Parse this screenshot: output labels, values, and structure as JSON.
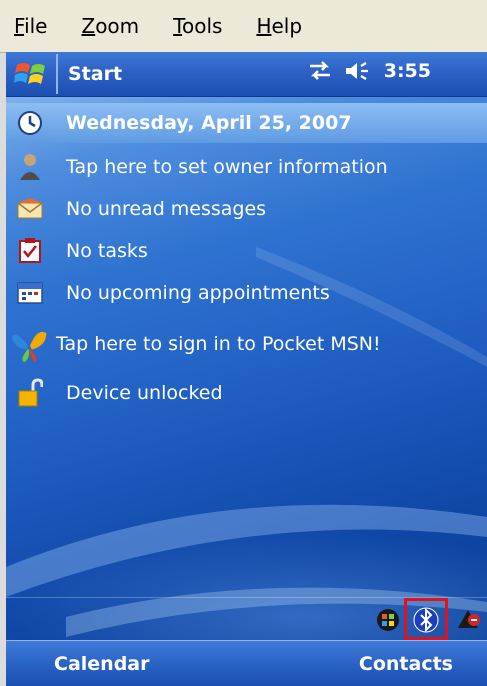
{
  "menubar": {
    "items": [
      {
        "label_ul": "F",
        "label_rest": "ile"
      },
      {
        "label_ul": "Z",
        "label_rest": "oom"
      },
      {
        "label_ul": "T",
        "label_rest": "ools"
      },
      {
        "label_ul": "H",
        "label_rest": "elp"
      }
    ]
  },
  "titlebar": {
    "start_label": "Start",
    "clock": "3:55"
  },
  "today": {
    "date": "Wednesday, April 25, 2007",
    "items": [
      {
        "label": "Tap here to set owner information"
      },
      {
        "label": "No unread messages"
      },
      {
        "label": "No tasks"
      },
      {
        "label": "No upcoming appointments"
      },
      {
        "label": "Tap here to sign in to Pocket MSN!"
      },
      {
        "label": "Device unlocked"
      }
    ]
  },
  "softkeys": {
    "left": "Calendar",
    "right": "Contacts"
  },
  "colors": {
    "highlight": "#e0121b",
    "titlebar": "#2f64c6"
  }
}
